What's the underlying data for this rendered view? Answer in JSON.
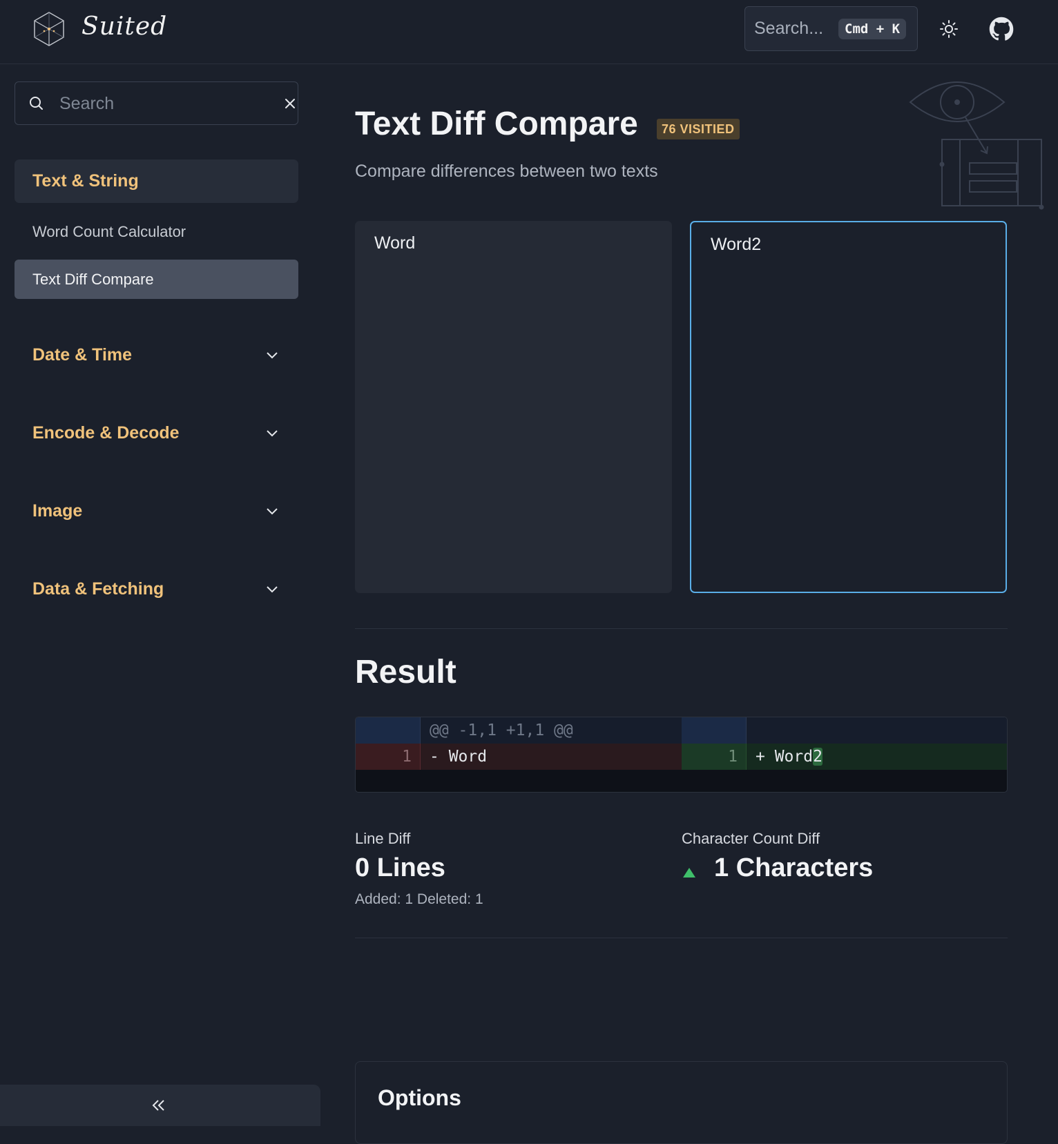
{
  "header": {
    "logo_text": "Suited",
    "search_placeholder": "Search...",
    "shortcut": "Cmd + K"
  },
  "sidebar": {
    "search_placeholder": "Search",
    "groups": [
      {
        "label": "Text & String",
        "expanded": true,
        "items": [
          "Word Count Calculator",
          "Text Diff Compare"
        ],
        "selected_item": "Text Diff Compare"
      },
      {
        "label": "Date & Time",
        "expanded": false
      },
      {
        "label": "Encode & Decode",
        "expanded": false
      },
      {
        "label": "Image",
        "expanded": false
      },
      {
        "label": "Data & Fetching",
        "expanded": false
      }
    ]
  },
  "main": {
    "title": "Text Diff Compare",
    "badge": "76 VISITIED",
    "subtitle": "Compare differences between two texts",
    "left_text": "Word",
    "right_text": "Word2",
    "result_heading": "Result",
    "diff": {
      "hunk": "@@ -1,1 +1,1 @@",
      "left_line_no": "1",
      "left_line": "- Word",
      "right_line_no": "1",
      "right_line_prefix": "+ Word",
      "right_line_highlight": "2"
    },
    "stats": {
      "line_diff_label": "Line Diff",
      "line_diff_value": "0 Lines",
      "line_diff_help": "Added: 1 Deleted: 1",
      "char_diff_label": "Character Count Diff",
      "char_diff_value": "1 Characters",
      "char_diff_direction": "increase"
    },
    "options_heading": "Options"
  },
  "colors": {
    "background": "#1b202b",
    "accent_gold": "#f0c27b",
    "focus_blue": "#5aaee8",
    "increase_green": "#3fbf6a"
  }
}
